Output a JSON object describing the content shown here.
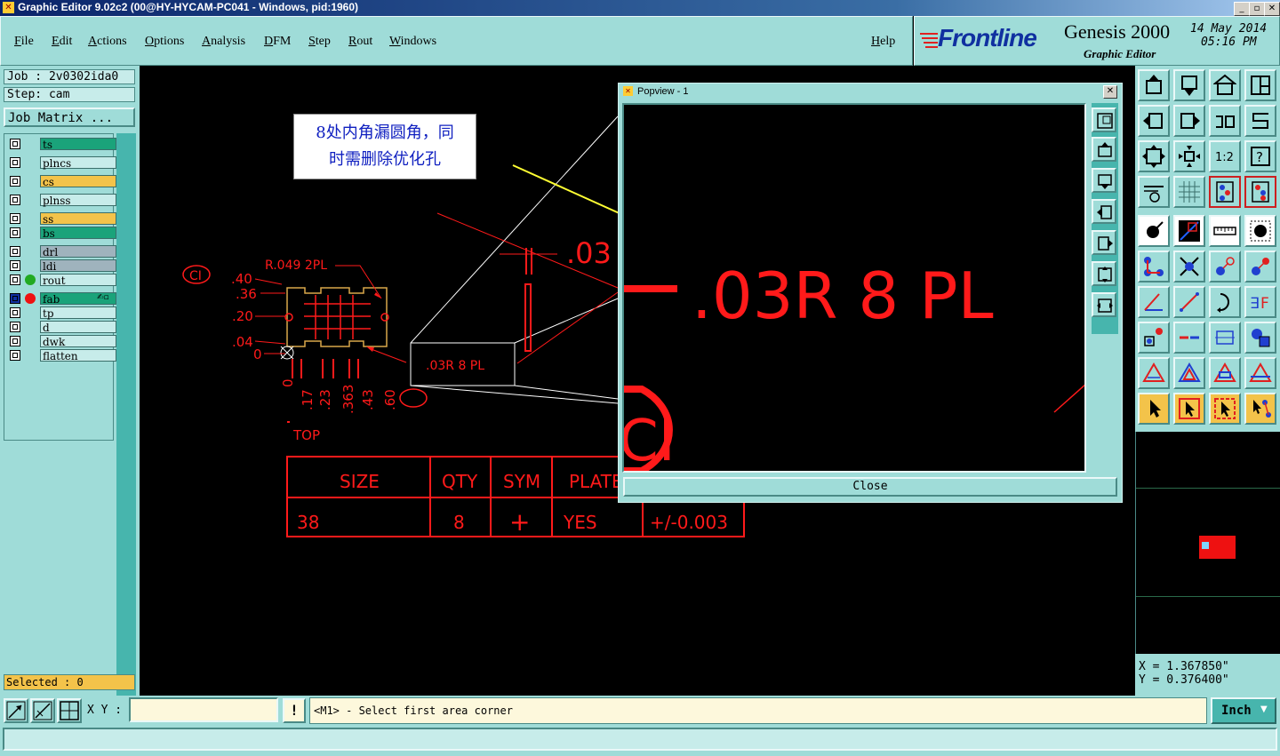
{
  "window": {
    "title": "Graphic Editor 9.02c2 (00@HY-HYCAM-PC041 - Windows, pid:1960)",
    "minimize": "_",
    "restore": "▫",
    "close": "✕"
  },
  "menu": {
    "items": [
      "File",
      "Edit",
      "Actions",
      "Options",
      "Analysis",
      "DFM",
      "Step",
      "Rout",
      "Windows"
    ],
    "help": "Help"
  },
  "brand": {
    "logo": "Frontline",
    "product": "Genesis 2000",
    "subtitle": "Graphic Editor",
    "date": "14 May 2014",
    "time": "05:16 PM"
  },
  "job": {
    "job_label": "Job : 2v0302ida0",
    "step_label": "Step: cam",
    "matrix_button": "Job Matrix ..."
  },
  "layers": [
    {
      "name": "ts",
      "color": "#1aa37a"
    },
    {
      "name": "plncs",
      "color": "#c7ecea"
    },
    {
      "name": "cs",
      "color": "#f3c34a"
    },
    {
      "name": "plnss",
      "color": "#c7ecea"
    },
    {
      "name": "ss",
      "color": "#f3c34a"
    },
    {
      "name": "bs",
      "color": "#1aa37a"
    },
    {
      "name": "drl",
      "color": "#9fb3bd"
    },
    {
      "name": "ldi",
      "color": "#9fb3bd"
    },
    {
      "name": "rout",
      "color": "#c7ecea"
    },
    {
      "name": "fab",
      "color": "#1aa37a"
    },
    {
      "name": "tp",
      "color": "#c7ecea"
    },
    {
      "name": "d",
      "color": "#c7ecea"
    },
    {
      "name": "dwk",
      "color": "#c7ecea"
    },
    {
      "name": "flatten",
      "color": "#c7ecea"
    }
  ],
  "selected": "Selected : 0",
  "annotation": {
    "line1": "8处内角漏圆角，同",
    "line2": "时需删除优化孔"
  },
  "drawing": {
    "radius_label": "R.049 2PL",
    "callout_label": ".03R 8 PL",
    "top_label": "TOP",
    "ci_label": "CI",
    "partial_dim": ".03",
    "y_dims": [
      ".40",
      ".36",
      ".20",
      ".04",
      "0"
    ],
    "x_dims": [
      "0",
      ".17",
      ".23",
      ".363",
      ".43",
      ".60"
    ],
    "table": {
      "headers": [
        "SIZE",
        "QTY",
        "SYM",
        "PLATE"
      ],
      "row": [
        "38",
        "8",
        "+",
        "YES",
        "+/-0.003"
      ]
    }
  },
  "popview": {
    "title": "Popview - 1",
    "zoom_label": ".03R 8 PL",
    "ci_label": "CI",
    "close_button": "Close"
  },
  "coords": {
    "x": "X = 1.367850\"",
    "y": "Y = 0.376400\""
  },
  "status": {
    "xy_label": "X Y :",
    "xy_value": "",
    "alert": "!",
    "message": "<M1> - Select first area corner",
    "units": "Inch"
  },
  "colors": {
    "panel": "#9fdcd8",
    "drawing_red": "#ff1a1a",
    "outline_yellow": "#d9a84a"
  }
}
